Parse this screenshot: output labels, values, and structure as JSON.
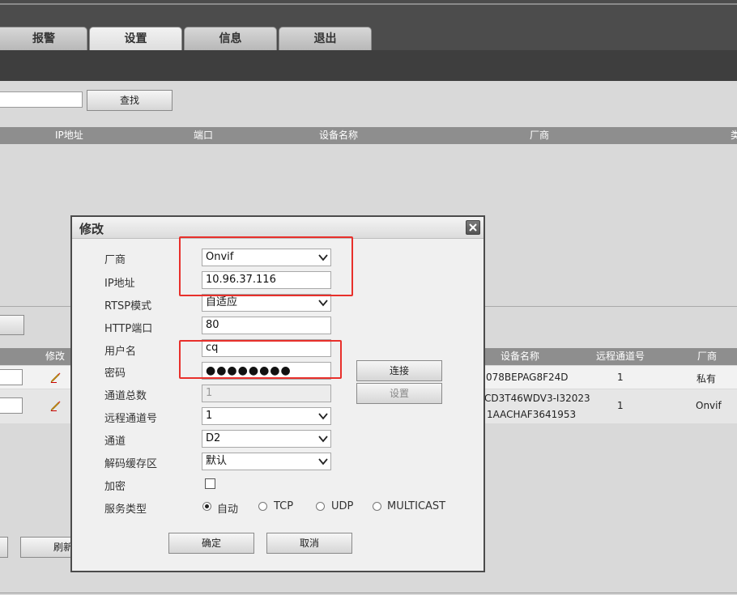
{
  "tabs": [
    {
      "label": "报警"
    },
    {
      "label": "设置"
    },
    {
      "label": "信息"
    },
    {
      "label": "退出"
    }
  ],
  "search": {
    "button_label": "查找"
  },
  "search_table": {
    "headers": [
      "IP地址",
      "端口",
      "设备名称",
      "厂商"
    ]
  },
  "added_table": {
    "headers": {
      "edit": "修改",
      "device_name": "设备名称",
      "remote_channel": "远程通道号",
      "vendor": "厂商"
    },
    "rows": [
      {
        "device_name": "078BEPAG8F24D",
        "remote_channel": "1",
        "vendor": "私有"
      },
      {
        "device_name_line1": "CD3T46WDV3-I32023",
        "device_name_line2": "1AACHAF3641953",
        "remote_channel": "1",
        "vendor": "Onvif"
      }
    ]
  },
  "bottom_buttons": {
    "refresh_label": "刷新"
  },
  "dialog": {
    "title": "修改",
    "labels": {
      "vendor": "厂商",
      "ip": "IP地址",
      "rtsp_mode": "RTSP模式",
      "http_port": "HTTP端口",
      "username": "用户名",
      "password": "密码",
      "total_channels": "通道总数",
      "remote_channel": "远程通道号",
      "channel": "通道",
      "decode_buffer": "解码缓存区",
      "encrypt": "加密",
      "service_type": "服务类型"
    },
    "values": {
      "vendor": "Onvif",
      "ip": "10.96.37.116",
      "rtsp_mode": "自适应",
      "http_port": "80",
      "username": "cq",
      "password": "●●●●●●●●",
      "total_channels": "1",
      "remote_channel": "1",
      "channel": "D2",
      "decode_buffer": "默认"
    },
    "service_options": [
      "自动",
      "TCP",
      "UDP",
      "MULTICAST"
    ],
    "selected_service": "自动",
    "encrypt_checked": false,
    "buttons": {
      "connect": "连接",
      "setup": "设置",
      "ok": "确定",
      "cancel": "取消"
    }
  },
  "colors": {
    "highlight_box": "#e8302b",
    "header_bg": "#8e8e8e",
    "topbar": "#4c4c4c"
  }
}
